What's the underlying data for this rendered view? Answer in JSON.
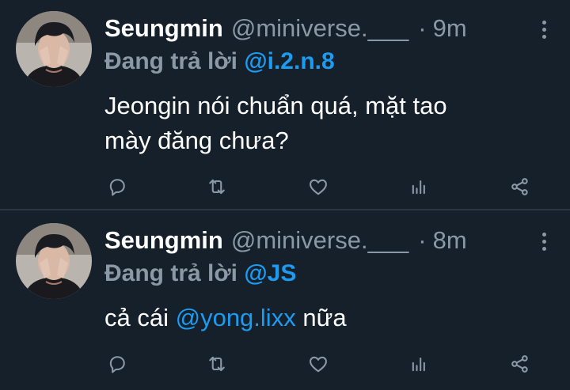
{
  "colors": {
    "background": "#15202b",
    "text_primary": "#ffffff",
    "text_secondary": "#8b98a5",
    "accent_link": "#1d9bf0",
    "divider": "#2a3742"
  },
  "tweets": [
    {
      "display_name": "Seungmin",
      "handle": "@miniverse.___",
      "separator": "·",
      "time": "9m",
      "reply_prefix": "Đang trả lời",
      "reply_to": "@i.2.n.8",
      "body_line1": "Jeongin nói chuẩn quá, mặt tao",
      "body_line2": "mày đăng chưa?",
      "icons": [
        "reply-icon",
        "retweet-icon",
        "like-icon",
        "views-icon",
        "share-icon",
        "more-icon"
      ]
    },
    {
      "display_name": "Seungmin",
      "handle": "@miniverse.___",
      "separator": "·",
      "time": "8m",
      "reply_prefix": "Đang trả lời",
      "reply_to": "@JS",
      "body_before": "cả cái",
      "body_link": "@yong.lixx",
      "body_after": "nữa",
      "icons": [
        "reply-icon",
        "retweet-icon",
        "like-icon",
        "views-icon",
        "share-icon",
        "more-icon"
      ]
    }
  ]
}
